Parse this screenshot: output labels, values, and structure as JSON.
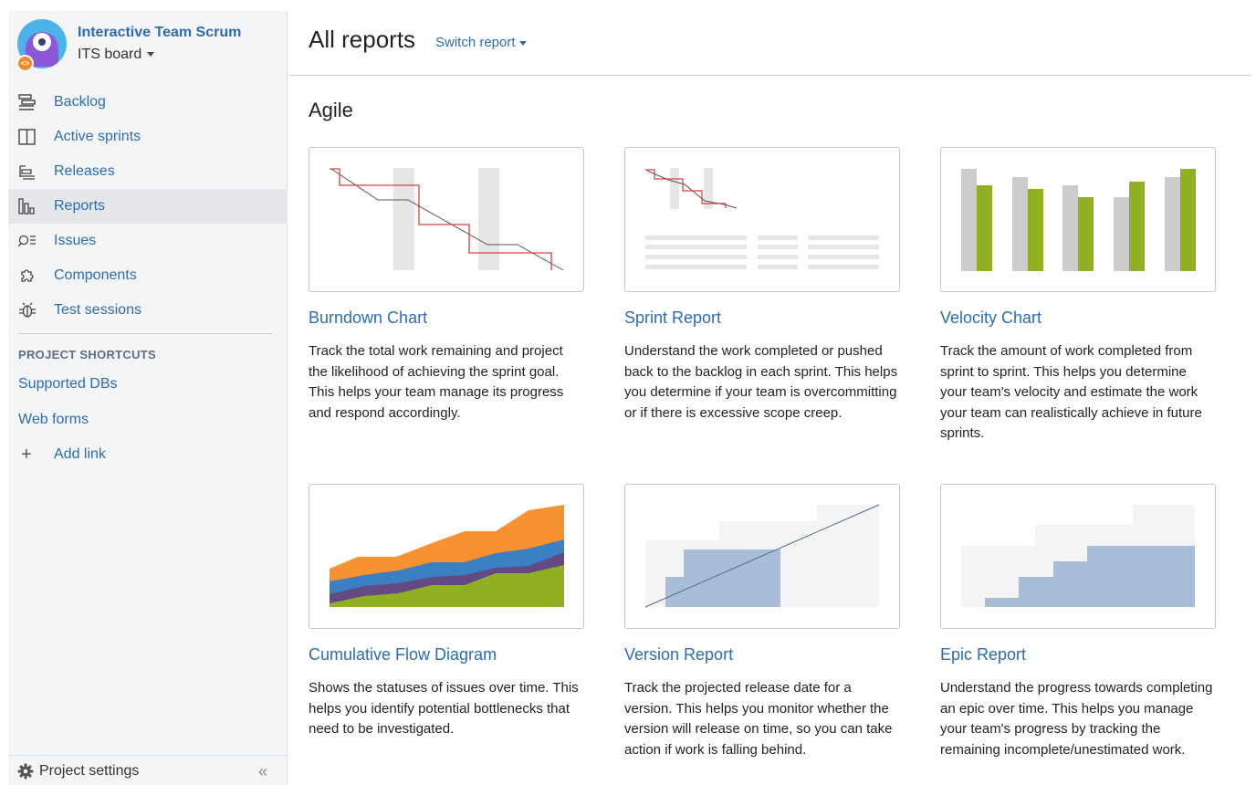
{
  "project": {
    "name": "Interactive Team Scrum",
    "board": "ITS board",
    "avatar_badge": "<>"
  },
  "nav": {
    "items": [
      {
        "label": "Backlog",
        "icon": "backlog-icon"
      },
      {
        "label": "Active sprints",
        "icon": "active-sprints-icon"
      },
      {
        "label": "Releases",
        "icon": "releases-icon"
      },
      {
        "label": "Reports",
        "icon": "reports-icon",
        "active": true
      },
      {
        "label": "Issues",
        "icon": "issues-icon"
      },
      {
        "label": "Components",
        "icon": "components-icon"
      },
      {
        "label": "Test sessions",
        "icon": "test-sessions-icon"
      }
    ]
  },
  "shortcuts": {
    "title": "PROJECT SHORTCUTS",
    "links": [
      "Supported DBs",
      "Web forms"
    ],
    "add_label": "Add link",
    "add_icon": "+"
  },
  "footer": {
    "settings_label": "Project settings",
    "collapse_glyph": "«"
  },
  "header": {
    "title": "All reports",
    "switch_label": "Switch report"
  },
  "section": {
    "title": "Agile"
  },
  "colors": {
    "link": "#2d6cb3",
    "burndown_line": "#d04437",
    "velocity_gray": "#cccccc",
    "velocity_green": "#8eb021",
    "cfd_orange": "#f79232",
    "cfd_blue": "#3b7fc4",
    "cfd_purple": "#654982",
    "cfd_green": "#8eb021",
    "progress_blue": "#a8bed8"
  },
  "reports": [
    {
      "title": "Burndown Chart",
      "desc": "Track the total work remaining and project the likelihood of achieving the sprint goal. This helps your team manage its progress and respond accordingly."
    },
    {
      "title": "Sprint Report",
      "desc": "Understand the work completed or pushed back to the backlog in each sprint. This helps you determine if your team is overcommitting or if there is excessive scope creep."
    },
    {
      "title": "Velocity Chart",
      "desc": "Track the amount of work completed from sprint to sprint. This helps you determine your team's velocity and estimate the work your team can realistically achieve in future sprints."
    },
    {
      "title": "Cumulative Flow Diagram",
      "desc": "Shows the statuses of issues over time. This helps you identify potential bottlenecks that need to be investigated."
    },
    {
      "title": "Version Report",
      "desc": "Track the projected release date for a version. This helps you monitor whether the version will release on time, so you can take action if work is falling behind."
    },
    {
      "title": "Epic Report",
      "desc": "Understand the progress towards completing an epic over time. This helps you manage your team's progress by tracking the remaining incomplete/unestimated work."
    }
  ]
}
